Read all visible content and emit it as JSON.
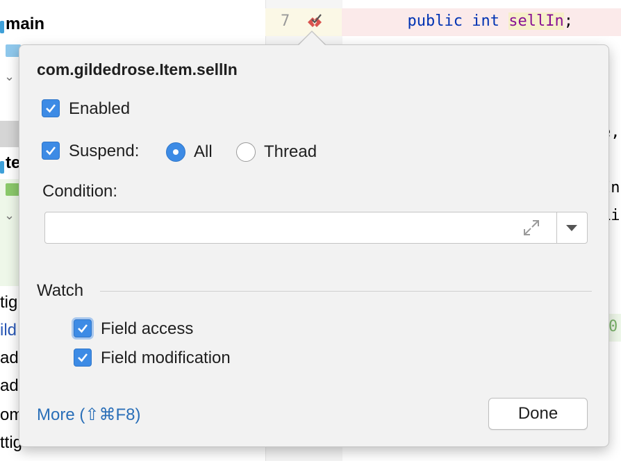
{
  "sidebar": {
    "rows": [
      {
        "text": "main"
      },
      {
        "text": "te"
      },
      {
        "text": "tig"
      },
      {
        "text": "ild"
      },
      {
        "text": "ad"
      },
      {
        "text": "ad"
      },
      {
        "text": "om"
      },
      {
        "text": "ttig"
      }
    ]
  },
  "editor": {
    "line_number": "7",
    "code_indent": "  ",
    "kw_public": "public",
    "kw_int": "int",
    "field_name": "sellIn",
    "semicolon": ";",
    "fragments": [
      "e,",
      "In",
      "Li",
      "0"
    ]
  },
  "popup": {
    "title": "com.gildedrose.Item.sellIn",
    "enabled_label": "Enabled",
    "suspend_label": "Suspend:",
    "radio_all_label": "All",
    "radio_thread_label": "Thread",
    "condition_label": "Condition:",
    "condition_value": "",
    "watch_label": "Watch",
    "field_access_label": "Field access",
    "field_modification_label": "Field modification",
    "more_link": "More (⇧⌘F8)",
    "done_label": "Done"
  },
  "state": {
    "enabled": true,
    "suspend": true,
    "suspend_policy": "All",
    "field_access": true,
    "field_modification": true
  },
  "icons": {
    "breakpoint": "field-watchpoint-icon",
    "expand": "expand-icon",
    "dropdown": "dropdown-arrow-icon"
  },
  "colors": {
    "accent": "#3d8be5",
    "link": "#2a6fb8",
    "keyword": "#0033b3",
    "field": "#871094",
    "breakpoint": "#d9534f"
  }
}
